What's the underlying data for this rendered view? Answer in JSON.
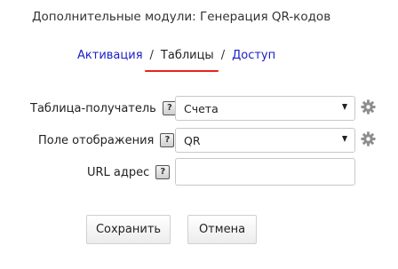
{
  "header": {
    "title": "Дополнительные модули: Генерация QR-кодов"
  },
  "tabs": {
    "activation": "Активация",
    "separator": "/",
    "tables": "Таблицы",
    "access": "Доступ",
    "active_tab": "tables",
    "active_underline_color": "#e8231c",
    "link_color": "#1a20c6"
  },
  "form": {
    "target_table": {
      "label": "Таблица-получатель",
      "help": "?",
      "colon": ":",
      "value": "Счета"
    },
    "display_field": {
      "label": "Поле отображения",
      "help": "?",
      "colon": ":",
      "value": "QR"
    },
    "url": {
      "label": "URL адрес",
      "help": "?",
      "colon": ":",
      "value": ""
    }
  },
  "buttons": {
    "save": "Сохранить",
    "cancel": "Отмена"
  },
  "icons": {
    "help": "help-icon",
    "settings": "gear-icon",
    "dropdown": "chevron-down-icon"
  }
}
